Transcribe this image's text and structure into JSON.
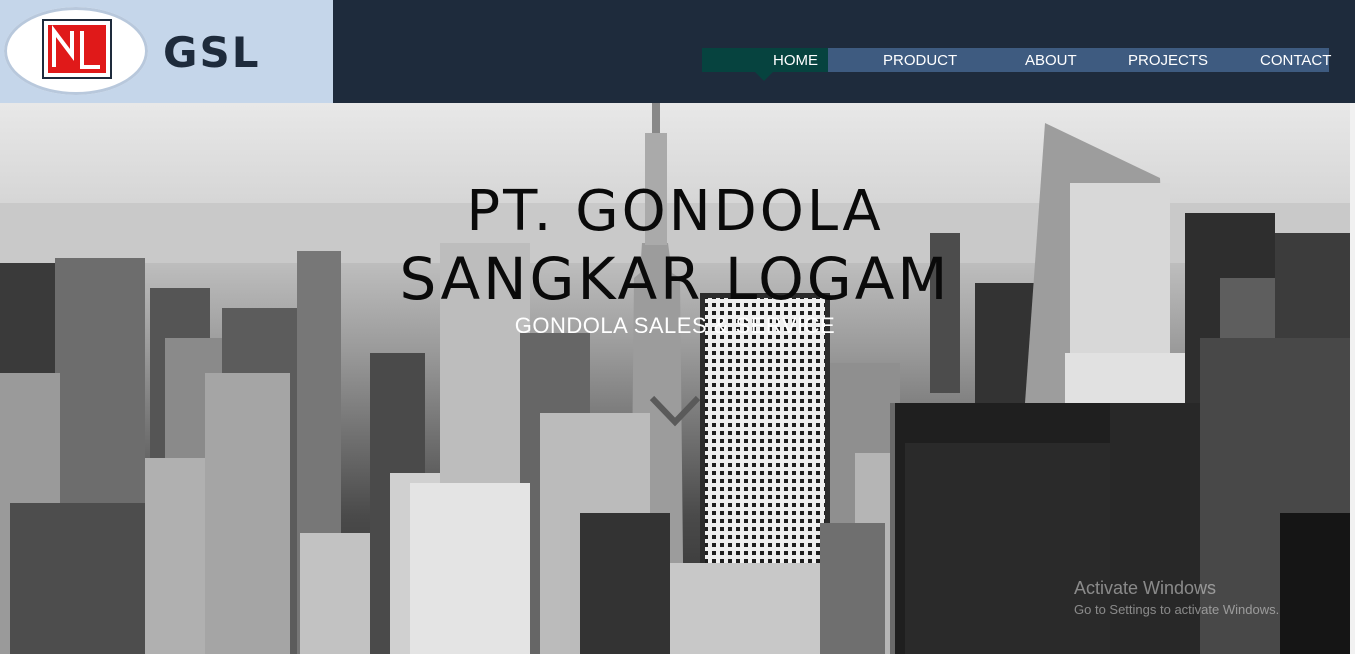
{
  "brand": {
    "logo_text": "GSL",
    "colors": {
      "header_bg": "#1e2b3c",
      "logo_bg": "#c5d6ea",
      "nav_bg": "#3e5b80",
      "nav_active": "#06433f",
      "logo_red": "#e01919"
    }
  },
  "nav": {
    "items": [
      {
        "label": "HOME",
        "active": true
      },
      {
        "label": "PRODUCT",
        "active": false
      },
      {
        "label": "ABOUT",
        "active": false
      },
      {
        "label": "PROJECTS",
        "active": false
      },
      {
        "label": "CONTACT",
        "active": false
      }
    ]
  },
  "hero": {
    "title_line1": "PT. GONDOLA",
    "title_line2": "SANGKAR LOGAM",
    "subtitle": "GONDOLA SALES & SERVICE",
    "scroll_icon": "chevron-down-icon"
  },
  "windows_watermark": {
    "line1": "Activate Windows",
    "line2": "Go to Settings to activate Windows."
  }
}
